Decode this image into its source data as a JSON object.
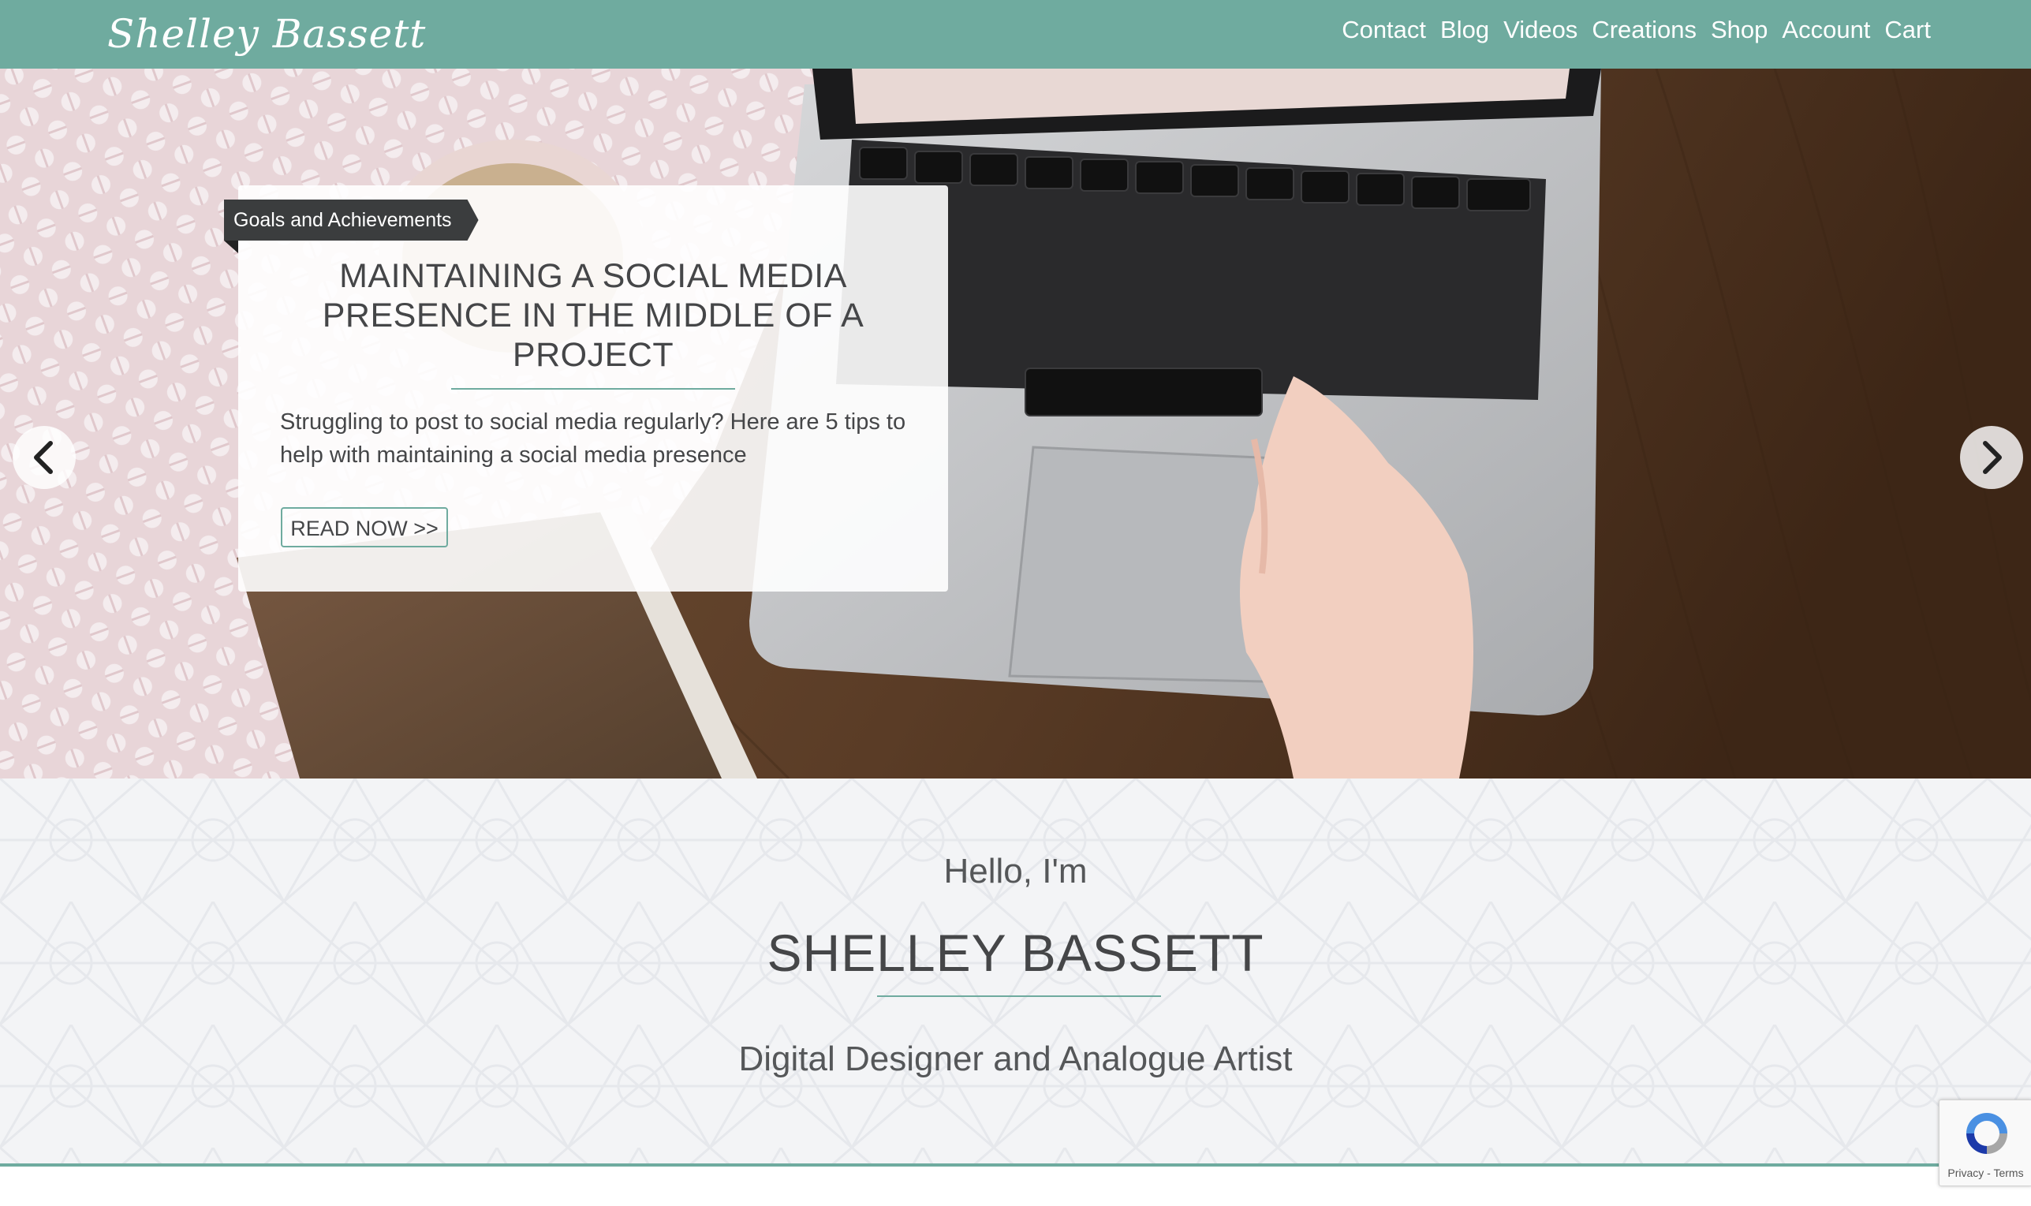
{
  "header": {
    "logo_text": "Shelley Bassett",
    "nav": [
      "Contact",
      "Blog",
      "Videos",
      "Creations",
      "Shop",
      "Account",
      "Cart"
    ]
  },
  "hero": {
    "category": "Goals and Achievements",
    "title": "MAINTAINING A SOCIAL MEDIA PRESENCE IN THE MIDDLE OF A PROJECT",
    "excerpt": "Struggling to post to social media regularly? Here are 5 tips to help with maintaining a social media presence",
    "button_label": "READ NOW >>",
    "prev_icon": "chevron-left-icon",
    "next_icon": "chevron-right-icon"
  },
  "intro": {
    "greeting": "Hello, I'm",
    "name": "SHELLEY BASSETT",
    "tagline": "Digital Designer and Analogue Artist"
  },
  "recaptcha": {
    "links": "Privacy - Terms"
  },
  "colors": {
    "accent": "#6fab9f",
    "text_dark": "#454648",
    "ribbon": "#3b3d3e",
    "section_bg": "#f3f4f6"
  }
}
